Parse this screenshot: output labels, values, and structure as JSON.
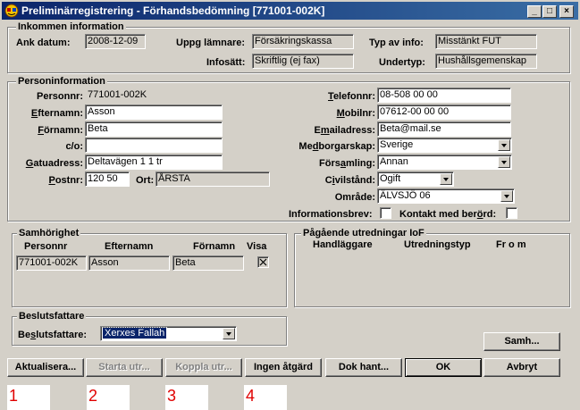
{
  "window": {
    "title": "Preliminärregistrering - Förhandsbedömning [771001-002K]",
    "controls": [
      "_",
      "□",
      "×"
    ]
  },
  "inkommen": {
    "group_title": "Inkommen information",
    "ank_datum_label": "Ank datum:",
    "ank_datum_value": "2008-12-09",
    "uppg_lamnare_label": "Uppg lämnare:",
    "uppg_lamnare_value": "Försäkringskassa",
    "typ_av_info_label": "Typ av info:",
    "typ_av_info_value": "Misstänkt FUT",
    "infosatt_label": "Infosätt:",
    "infosatt_value": "Skriftlig (ej fax)",
    "undertyp_label": "Undertyp:",
    "undertyp_value": "Hushållsgemenskap"
  },
  "person": {
    "group_title": "Personinformation",
    "personnr_label": "Personnr:",
    "personnr_value": "771001-002K",
    "efternamn_label": "Efternamn:",
    "efternamn_value": "Asson",
    "fornamn_label": "Förnamn:",
    "fornamn_value": "Beta",
    "co_label": "c/o:",
    "co_value": "",
    "gatuadress_label": "Gatuadress:",
    "gatuadress_value": "Deltavägen 1 1 tr",
    "postnr_label": "Postnr:",
    "postnr_value": "120 50",
    "ort_label": "Ort:",
    "ort_value": "ÅRSTA",
    "telefonnr_label": "Telefonnr:",
    "telefonnr_value": "08-508 00 00",
    "mobilnr_label": "Mobilnr:",
    "mobilnr_value": "07612-00 00 00",
    "email_label": "Emailadress:",
    "email_value": "Beta@mail.se",
    "medborgarskap_label": "Medborgarskap:",
    "medborgarskap_value": "Sverige",
    "forsamling_label": "Församling:",
    "forsamling_value": "Annan",
    "civilstand_label": "Civilstånd:",
    "civilstand_value": "Ogift",
    "omrade_label": "Område:",
    "omrade_value": "ÄLVSJÖ 06",
    "informationsbrev_label": "Informationsbrev:",
    "kontakt_label": "Kontakt med berörd:"
  },
  "samhorighet": {
    "group_title": "Samhörighet",
    "columns": [
      "Personnr",
      "Efternamn",
      "Förnamn",
      "Visa"
    ],
    "rows": [
      {
        "personnr": "771001-002K",
        "efternamn": "Asson",
        "fornamn": "Beta",
        "visa": "checked"
      }
    ]
  },
  "pagaende": {
    "group_title": "Pågående utredningar IoF",
    "columns": [
      "Handläggare",
      "Utredningstyp",
      "Fr o m"
    ]
  },
  "beslutsfattare": {
    "group_title": "Beslutsfattare",
    "label": "Beslutsfattare:",
    "value": "Xerxes Fallah"
  },
  "buttons": {
    "samh": "Samh...",
    "aktualisera": "Aktualisera...",
    "starta_utr": "Starta utr...",
    "koppla_utr": "Koppla utr...",
    "ingen_atgard": "Ingen åtgärd",
    "dok_hant": "Dok hant...",
    "ok": "OK",
    "avbryt": "Avbryt"
  },
  "annotations": [
    "1",
    "2",
    "3",
    "4"
  ],
  "colors": {
    "titlebar_start": "#0a246a",
    "titlebar_end": "#3a6ea5",
    "face": "#d4d0c8",
    "selection": "#0a246a",
    "annotation": "#e00000"
  }
}
